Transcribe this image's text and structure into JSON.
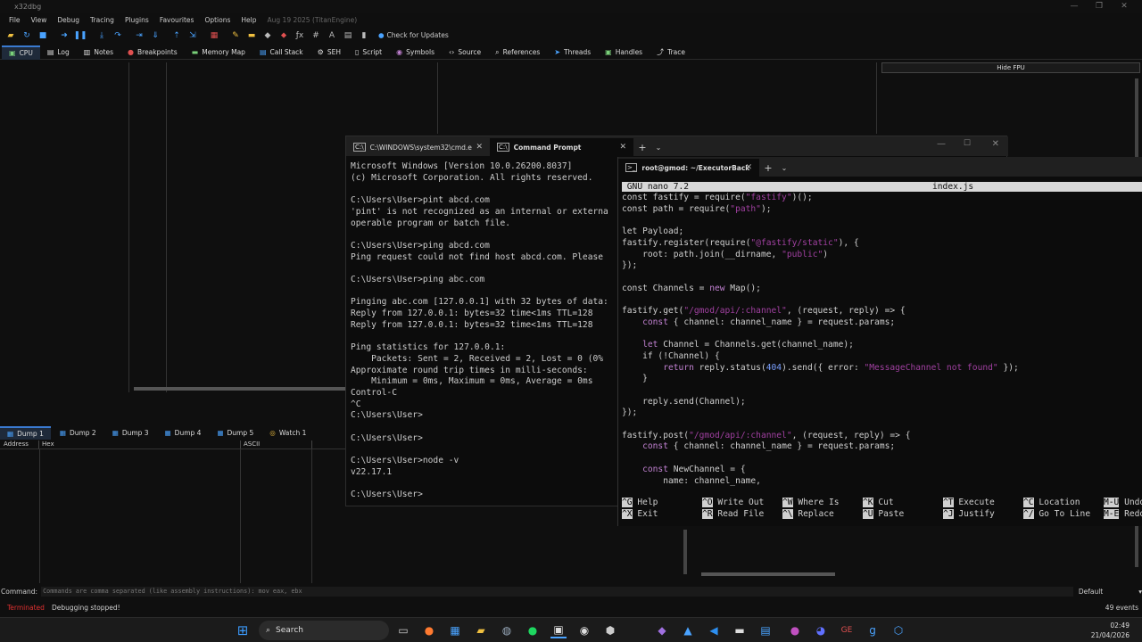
{
  "dbg": {
    "title": "x32dbg",
    "menu": [
      "File",
      "View",
      "Debug",
      "Tracing",
      "Plugins",
      "Favourites",
      "Options",
      "Help"
    ],
    "version": "Aug 19 2025 (TitanEngine)",
    "check_updates": "Check for Updates",
    "tabs": [
      "CPU",
      "Log",
      "Notes",
      "Breakpoints",
      "Memory Map",
      "Call Stack",
      "SEH",
      "Script",
      "Symbols",
      "Source",
      "References",
      "Threads",
      "Handles",
      "Trace"
    ],
    "hide_fpu": "Hide FPU",
    "dump_tabs": [
      "Dump 1",
      "Dump 2",
      "Dump 3",
      "Dump 4",
      "Dump 5",
      "Watch 1"
    ],
    "dump_headers": {
      "address": "Address",
      "hex": "Hex",
      "ascii": "ASCII"
    },
    "command_label": "Command:",
    "command_placeholder": "Commands are comma separated (like assembly instructions): mov eax, ebx",
    "command_mode": "Default",
    "status_state": "Terminated",
    "status_text": "Debugging stopped!",
    "events": "49 events"
  },
  "cmd": {
    "tab1": "C:\\WINDOWS\\system32\\cmd.e",
    "tab2": "Command Prompt",
    "lines": "Microsoft Windows [Version 10.0.26200.8037]\n(c) Microsoft Corporation. All rights reserved.\n\nC:\\Users\\User>pint abcd.com\n'pint' is not recognized as an internal or externa\noperable program or batch file.\n\nC:\\Users\\User>ping abcd.com\nPing request could not find host abcd.com. Please\n\nC:\\Users\\User>ping abc.com\n\nPinging abc.com [127.0.0.1] with 32 bytes of data:\nReply from 127.0.0.1: bytes=32 time<1ms TTL=128\nReply from 127.0.0.1: bytes=32 time<1ms TTL=128\n\nPing statistics for 127.0.0.1:\n    Packets: Sent = 2, Received = 2, Lost = 0 (0%\nApproximate round trip times in milli-seconds:\n    Minimum = 0ms, Maximum = 0ms, Average = 0ms\nControl-C\n^C\nC:\\Users\\User>\n\nC:\\Users\\User>\n\nC:\\Users\\User>node -v\nv22.17.1\n\nC:\\Users\\User>"
  },
  "nano": {
    "tab": "root@gmod: ~/ExecutorBack",
    "header_left": " GNU nano 7.2",
    "header_file": "index.js",
    "help_row1": [
      [
        "^G",
        "Help"
      ],
      [
        "^O",
        "Write Out"
      ],
      [
        "^W",
        "Where Is"
      ],
      [
        "^K",
        "Cut"
      ],
      [
        "^T",
        "Execute"
      ],
      [
        "^C",
        "Location"
      ],
      [
        "M-U",
        "Undo"
      ]
    ],
    "help_row2": [
      [
        "^X",
        "Exit"
      ],
      [
        "^R",
        "Read File"
      ],
      [
        "^\\",
        "Replace"
      ],
      [
        "^U",
        "Paste"
      ],
      [
        "^J",
        "Justify"
      ],
      [
        "^/",
        "Go To Line"
      ],
      [
        "M-E",
        "Redo"
      ]
    ]
  },
  "taskbar": {
    "search": "Search",
    "time": "02:49",
    "date": "21/04/2026"
  }
}
